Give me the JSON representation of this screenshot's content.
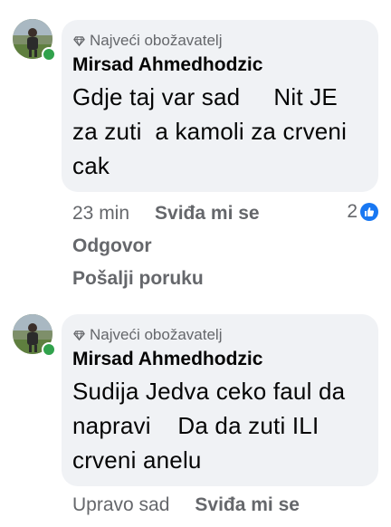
{
  "comments": [
    {
      "badge": "Najveći obožavatelj",
      "author": "Mirsad Ahmedhodzic",
      "text": "Gdje taj var sad     Nit JE za zuti  a kamoli za crveni cak",
      "time": "23 min",
      "like_label": "Sviđa mi se",
      "reaction_count": "2",
      "reply_label": "Odgovor",
      "message_label": "Pošalji poruku"
    },
    {
      "badge": "Najveći obožavatelj",
      "author": "Mirsad Ahmedhodzic",
      "text": "Sudija Jedva ceko faul da napravi    Da da zuti ILI crveni anelu",
      "time": "Upravo sad",
      "like_label": "Sviđa mi se"
    }
  ],
  "colors": {
    "bubble": "#f0f2f5",
    "secondary_text": "#65676b",
    "online": "#31a24c",
    "like": "#1877f2"
  }
}
